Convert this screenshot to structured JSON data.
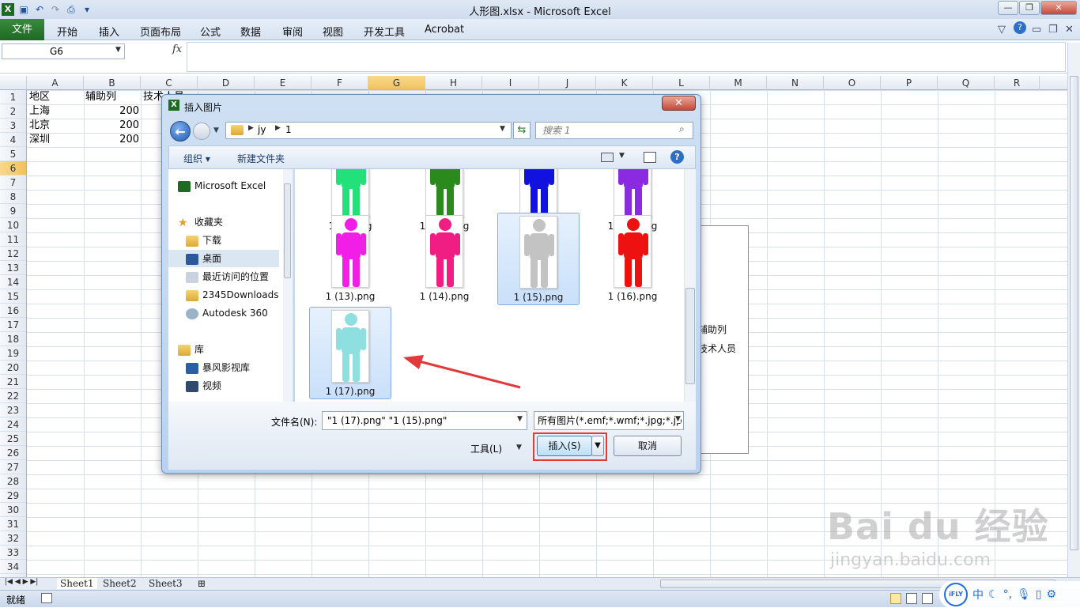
{
  "window": {
    "title": "人形图.xlsx  -  Microsoft Excel"
  },
  "ribbon": {
    "file": "文件",
    "tabs": [
      "开始",
      "插入",
      "页面布局",
      "公式",
      "数据",
      "审阅",
      "视图",
      "开发工具",
      "Acrobat"
    ]
  },
  "formula": {
    "namebox": "G6",
    "fx": "fx",
    "content": ""
  },
  "columns": [
    "A",
    "B",
    "C",
    "D",
    "E",
    "F",
    "G",
    "H",
    "I",
    "J",
    "K",
    "L",
    "M",
    "N",
    "O",
    "P",
    "Q",
    "R"
  ],
  "rows": [
    "1",
    "2",
    "3",
    "4",
    "5",
    "6",
    "7",
    "8",
    "9",
    "10",
    "11",
    "12",
    "13",
    "14",
    "15",
    "16",
    "17",
    "18",
    "19",
    "20",
    "21",
    "22",
    "23",
    "24",
    "25",
    "26",
    "27",
    "28",
    "29",
    "30",
    "31",
    "32",
    "33",
    "34"
  ],
  "cells": {
    "a1": "地区",
    "b1": "辅助列",
    "c1": "技术人员",
    "a2": "上海",
    "b2": "200",
    "a3": "北京",
    "b3": "200",
    "a4": "深圳",
    "b4": "200"
  },
  "chart": {
    "legend1": "辅助列",
    "legend2": "技术人员"
  },
  "sheets": [
    "Sheet1",
    "Sheet2",
    "Sheet3"
  ],
  "status": {
    "ready": "就绪"
  },
  "dialog": {
    "title": "插入图片",
    "path": [
      "jy",
      "1"
    ],
    "search_placeholder": "搜索 1",
    "organize": "组织 ▾",
    "new_folder": "新建文件夹",
    "nav": {
      "excel": "Microsoft Excel",
      "favorites": "收藏夹",
      "downloads": "下载",
      "desktop": "桌面",
      "recent": "最近访问的位置",
      "d2345": "2345Downloads",
      "autodesk": "Autodesk 360",
      "library": "库",
      "storm": "暴风影视库",
      "video": "视频"
    },
    "files": [
      {
        "name": "1 (9).png",
        "color": "#22e07a",
        "selected": false
      },
      {
        "name": "1 (10).png",
        "color": "#2a8a1c",
        "selected": false
      },
      {
        "name": "1 (11).png",
        "color": "#1212e0",
        "selected": false
      },
      {
        "name": "1 (12).png",
        "color": "#8a2be2",
        "selected": false
      },
      {
        "name": "1 (13).png",
        "color": "#f01ee6",
        "selected": false
      },
      {
        "name": "1 (14).png",
        "color": "#f01e82",
        "selected": false
      },
      {
        "name": "1 (15).png",
        "color": "#c3c3c3",
        "selected": true
      },
      {
        "name": "1 (16).png",
        "color": "#ee1111",
        "selected": false
      },
      {
        "name": "1 (17).png",
        "color": "#8ee0e0",
        "selected": true
      }
    ],
    "filename_label": "文件名(N):",
    "filename_value": "\"1 (17).png\" \"1 (15).png\"",
    "filetype": "所有图片(*.emf;*.wmf;*.jpg;*.jp",
    "tools": "工具(L)",
    "insert": "插入(S)",
    "cancel": "取消"
  },
  "watermark": {
    "brand": "Bai du 经验",
    "url": "jingyan.baidu.com"
  },
  "colors": {
    "excel_green": "#1d6a22",
    "selection_red": "#e53935",
    "arrow_red": "#e03a3a"
  }
}
